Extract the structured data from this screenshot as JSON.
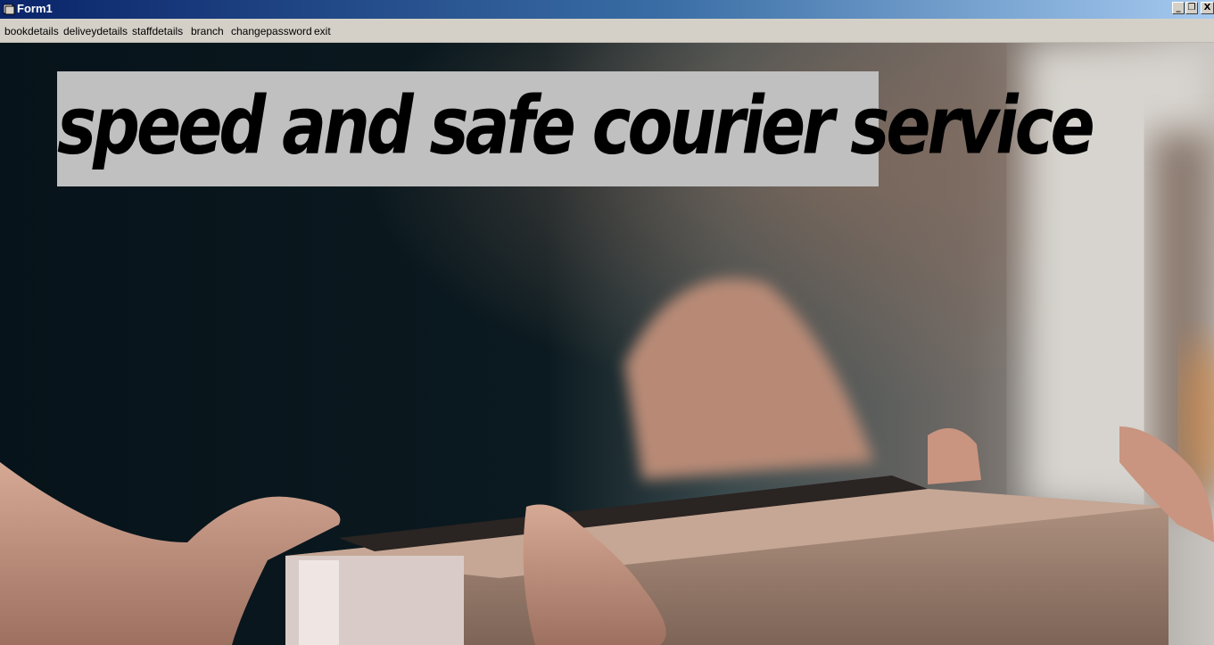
{
  "window": {
    "title": "Form1",
    "icon": "form-icon",
    "controls": {
      "minimize_label": "_",
      "maximize_label": "❐",
      "close_label": "X"
    }
  },
  "menu": {
    "items": [
      {
        "label": "bookdetails"
      },
      {
        "label": "deliveydetails"
      },
      {
        "label": "staffdetails"
      },
      {
        "label": "branch"
      },
      {
        "label": "changepassword"
      },
      {
        "label": "exit"
      }
    ]
  },
  "banner": {
    "text": "speed and safe courier service"
  },
  "colors": {
    "titlebar_start": "#0a246a",
    "titlebar_end": "#a6caf0",
    "menubar": "#d4d0c8",
    "banner_bg": "#c0c0c0"
  }
}
